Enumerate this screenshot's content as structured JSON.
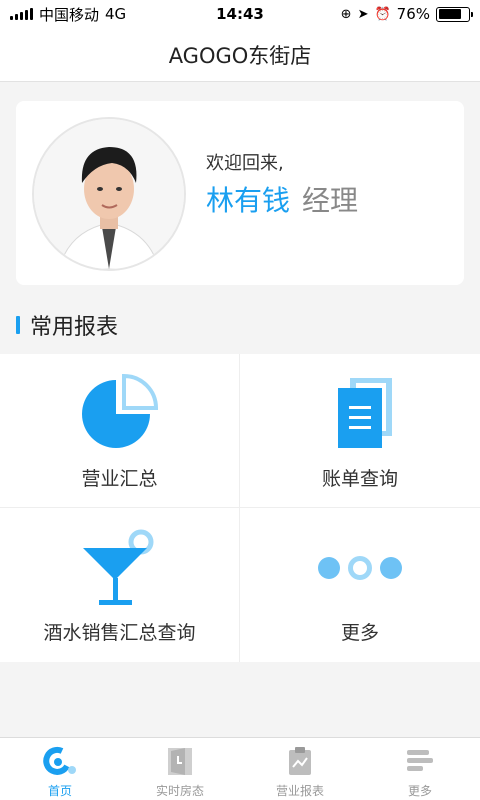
{
  "status_bar": {
    "carrier": "中国移动",
    "network": "4G",
    "time": "14:43",
    "battery": "76%",
    "battery_level": 0.76
  },
  "nav": {
    "title": "AGOGO东街店"
  },
  "profile": {
    "welcome": "欢迎回来,",
    "name": "林有钱",
    "role": "经理"
  },
  "section": {
    "title": "常用报表"
  },
  "reports": [
    {
      "label": "营业汇总",
      "icon": "pie-chart-icon"
    },
    {
      "label": "账单查询",
      "icon": "document-icon"
    },
    {
      "label": "酒水销售汇总查询",
      "icon": "cocktail-icon"
    },
    {
      "label": "更多",
      "icon": "more-dots-icon"
    }
  ],
  "tabs": [
    {
      "label": "首页",
      "icon": "home-icon",
      "active": true
    },
    {
      "label": "实时房态",
      "icon": "door-icon",
      "active": false
    },
    {
      "label": "营业报表",
      "icon": "clipboard-chart-icon",
      "active": false
    },
    {
      "label": "更多",
      "icon": "menu-lines-icon",
      "active": false
    }
  ],
  "colors": {
    "accent": "#1a9ff0",
    "accent_light": "#9fd8f8",
    "inactive": "#999999"
  }
}
